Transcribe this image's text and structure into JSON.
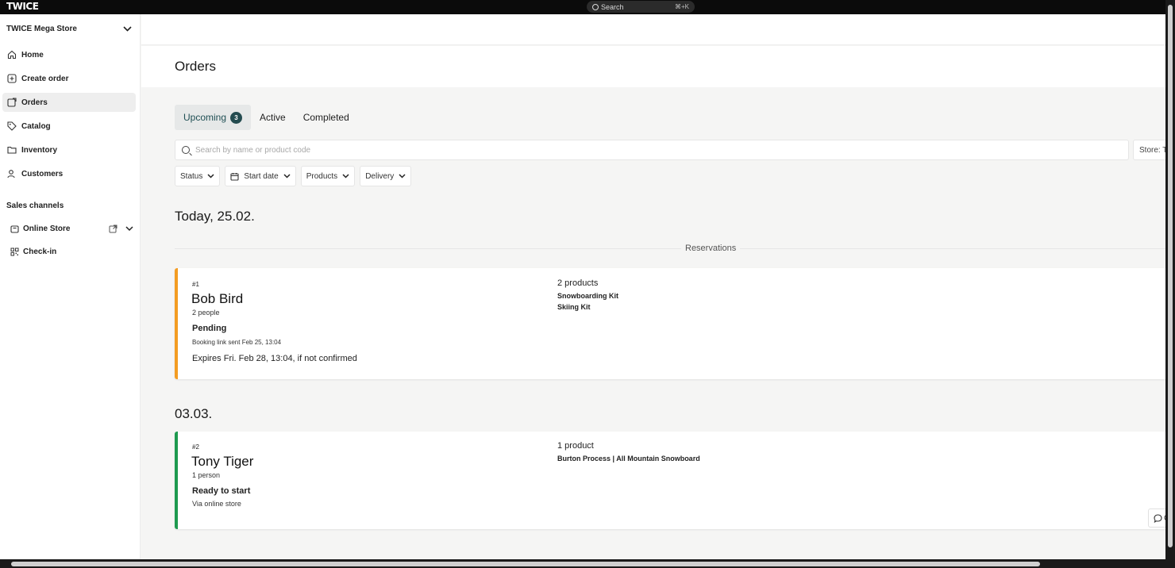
{
  "app": {
    "logo": "TWICE"
  },
  "topbar": {
    "search_label": "Search",
    "shortcut": "⌘+K"
  },
  "sidebar": {
    "store_name": "TWICE Mega Store",
    "nav": [
      {
        "label": "Home",
        "icon": "home-icon"
      },
      {
        "label": "Create order",
        "icon": "plus-square-icon"
      },
      {
        "label": "Orders",
        "icon": "orders-icon",
        "active": true
      },
      {
        "label": "Catalog",
        "icon": "tag-icon"
      },
      {
        "label": "Inventory",
        "icon": "folder-icon"
      },
      {
        "label": "Customers",
        "icon": "users-icon"
      }
    ],
    "sales_channels_label": "Sales channels",
    "channels": [
      {
        "label": "Online Store",
        "icon": "store-icon"
      },
      {
        "label": "Check-in",
        "icon": "qr-code-icon"
      }
    ]
  },
  "main": {
    "title": "Orders",
    "tabs": [
      {
        "label": "Upcoming",
        "badge": "3",
        "active": true
      },
      {
        "label": "Active"
      },
      {
        "label": "Completed"
      }
    ],
    "search_placeholder": "Search by name or product code",
    "store_filter": "Store: T",
    "filters": [
      "Status",
      "Start date",
      "Products",
      "Delivery"
    ],
    "groups": [
      {
        "date": "Today, 25.02.",
        "divider_label": "Reservations",
        "orders": [
          {
            "number": "#1",
            "name": "Bob Bird",
            "people": "2 people",
            "status": "Pending",
            "status_detail": "Booking link sent Feb 25, 13:04",
            "expires": "Expires Fri. Feb 28, 13:04, if not confirmed",
            "product_count": "2 products",
            "products": [
              "Snowboarding Kit",
              "Skiing Kit"
            ],
            "accent": "#f39c22"
          }
        ]
      },
      {
        "date": "03.03.",
        "orders": [
          {
            "number": "#2",
            "name": "Tony Tiger",
            "people": "1 person",
            "status": "Ready to start",
            "status_detail": "Via online store",
            "product_count": "1 product",
            "products": [
              "Burton Process | All Mountain Snowboard"
            ],
            "accent": "#1e9a4f",
            "comment_button": "Co"
          }
        ]
      }
    ]
  }
}
